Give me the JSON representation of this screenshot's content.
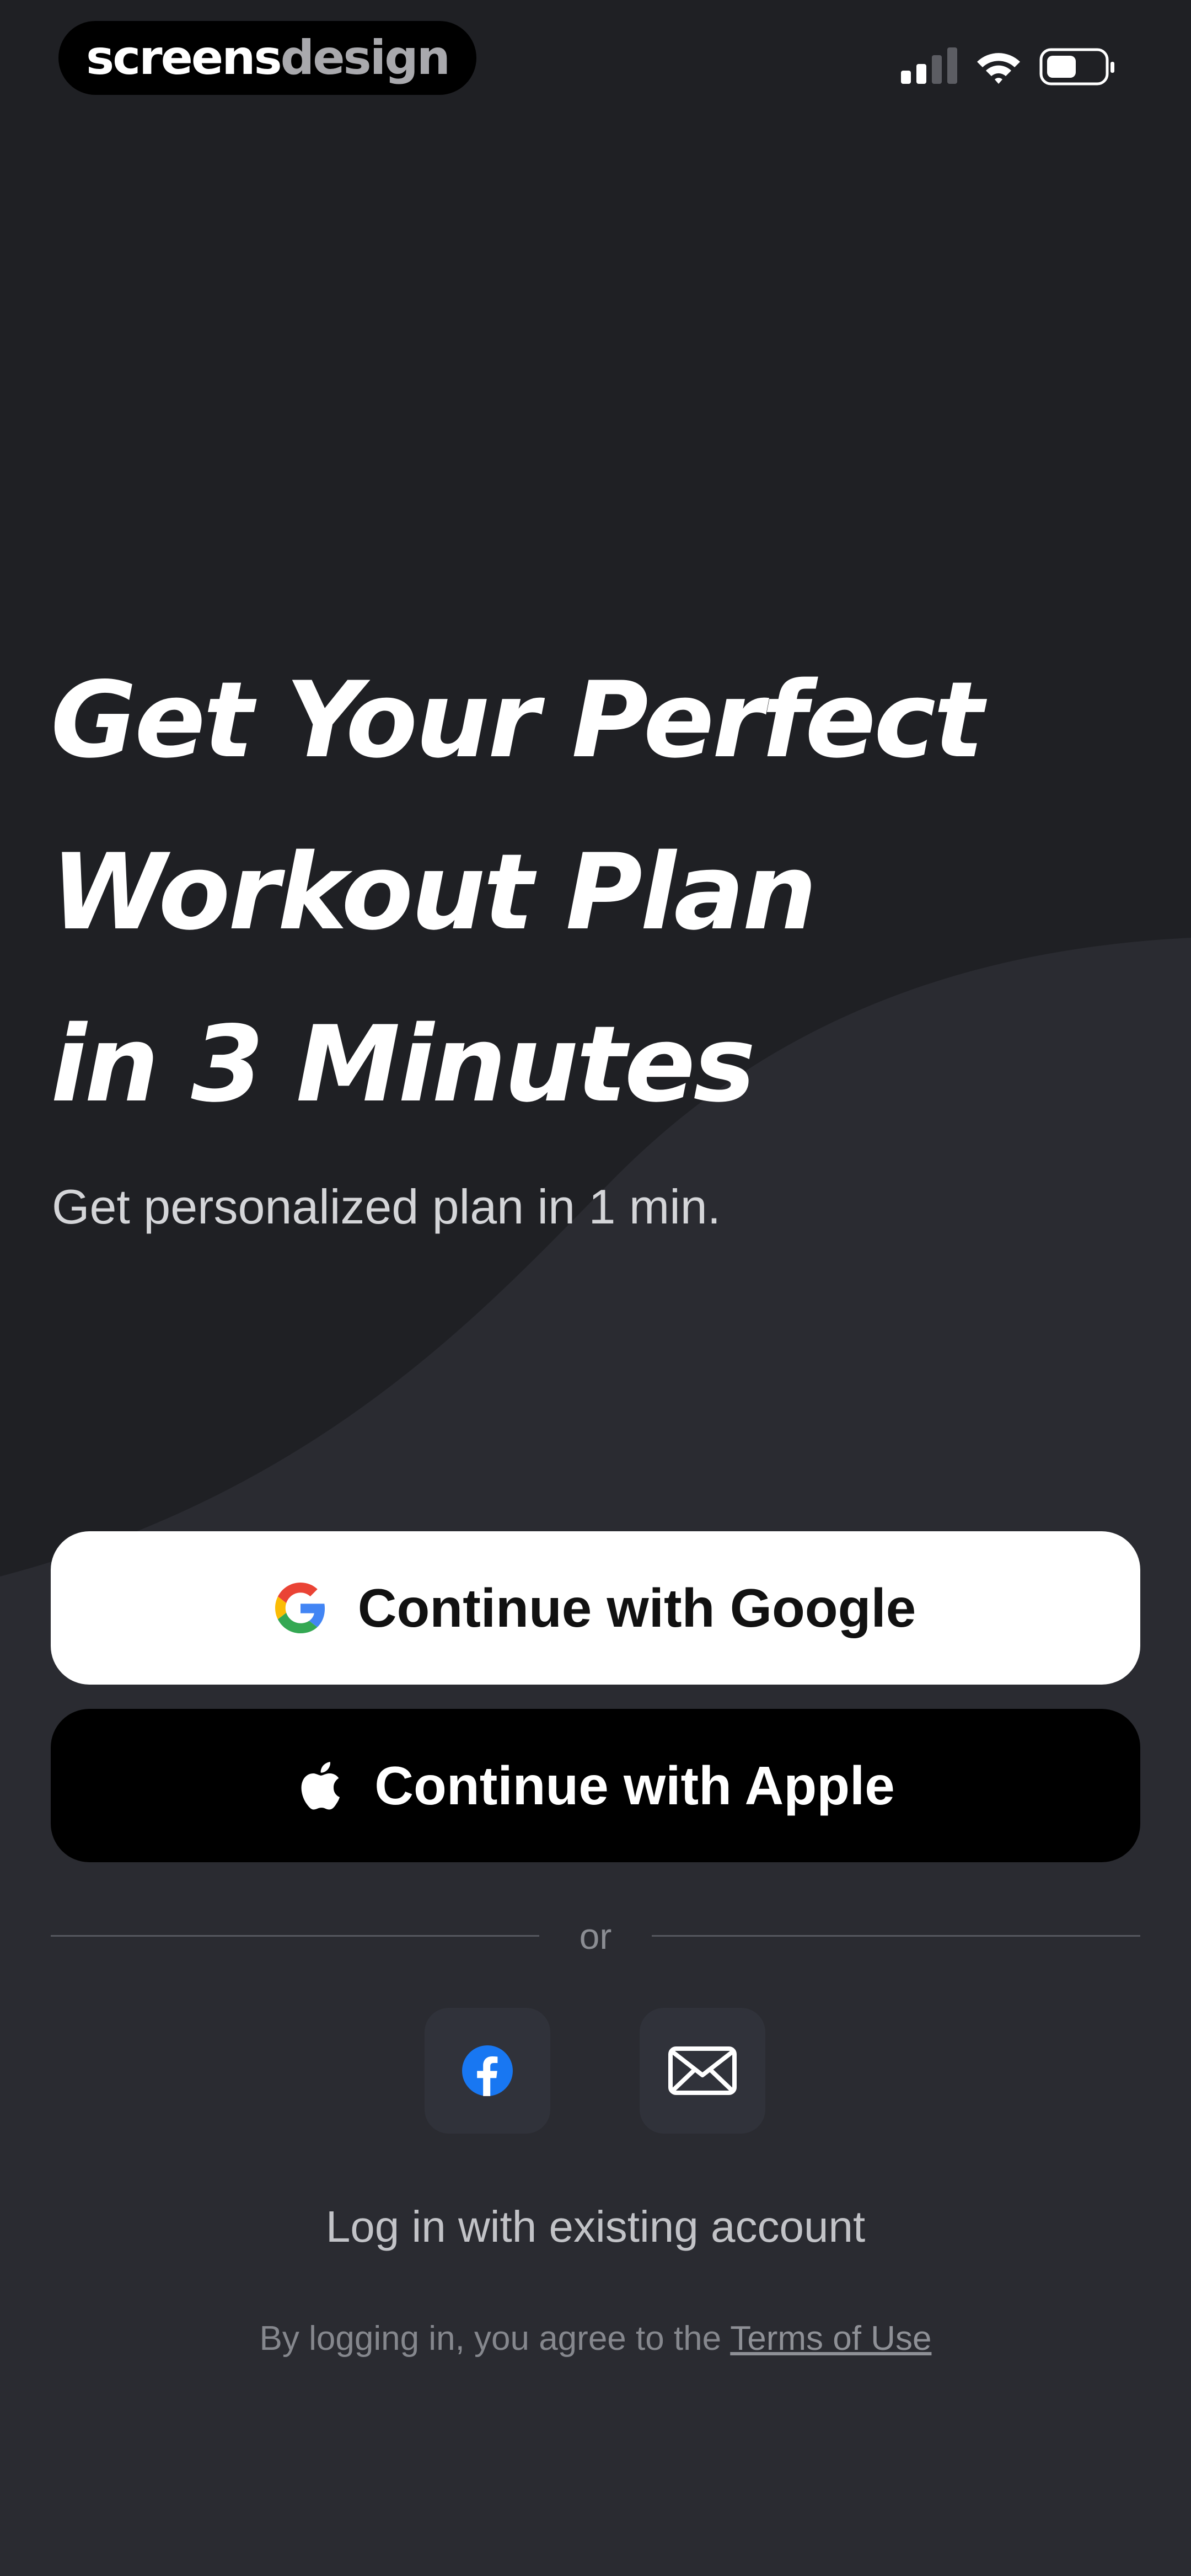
{
  "status_bar": {
    "brand_part1": "screens",
    "brand_part2": "design",
    "icons": [
      "cellular-signal-icon",
      "wifi-icon",
      "battery-icon"
    ]
  },
  "hero": {
    "headline_lines": [
      "Get Your Perfect",
      "Workout Plan",
      "in 3 Minutes"
    ],
    "subheadline": "Get personalized plan in 1 min."
  },
  "auth": {
    "google_label": "Continue with Google",
    "apple_label": "Continue with Apple",
    "divider_text": "or",
    "social_icons": [
      "facebook-icon",
      "mail-icon"
    ],
    "login_link": "Log in with existing account",
    "legal_prefix": "By logging in, you agree to the",
    "legal_link": "Terms of Use"
  },
  "colors": {
    "background": "#1f2024",
    "wave": "#2a2b31",
    "google_button": "#ffffff",
    "apple_button": "#000000",
    "facebook_blue": "#1877f2"
  }
}
